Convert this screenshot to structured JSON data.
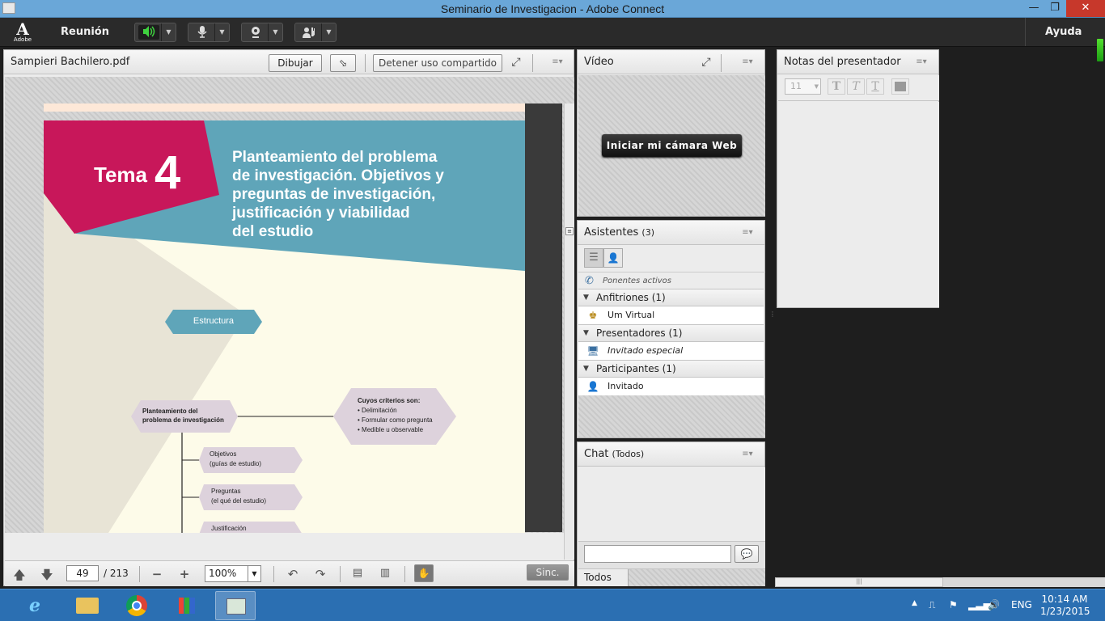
{
  "window": {
    "title": "Seminario de Investigacion - Adobe Connect",
    "minimize": "—",
    "restore": "❐",
    "close": "✕"
  },
  "menubar": {
    "logo_text": "Adobe",
    "meeting_label": "Reunión",
    "help_label": "Ayuda",
    "icons": [
      "speaker-icon",
      "microphone-icon",
      "webcam-icon",
      "raise-hand-icon"
    ]
  },
  "share_pod": {
    "title": "Sampieri Bachilero.pdf",
    "draw_button": "Dibujar",
    "stop_sharing_button": "Detener uso compartido",
    "current_page": "49",
    "total_pages": "/ 213",
    "zoom": "100%",
    "sync_button": "Sinc."
  },
  "slide": {
    "tema_label": "Tema",
    "tema_number": "4",
    "heading_lines": [
      "Planteamiento del problema",
      "de investigación. Objetivos y",
      "preguntas de investigación,",
      "justificación y viabilidad",
      "del estudio"
    ],
    "structure_label": "Estructura",
    "problem_box_lines": [
      "Planteamiento del",
      "problema de investigación"
    ],
    "criteria_title": "Cuyos criterios son:",
    "criteria_items": [
      "• Delimitación",
      "• Formular como pregunta",
      "• Medible u observable"
    ],
    "branch_1": [
      "Objetivos",
      "(guías de estudio)"
    ],
    "branch_2": [
      "Preguntas",
      "(el qué del estudio)"
    ],
    "branch_3": [
      "Justificación"
    ]
  },
  "video_pod": {
    "title": "Vídeo",
    "start_camera_button": "Iniciar mi cámara Web"
  },
  "attendees_pod": {
    "title": "Asistentes",
    "count": "(3)",
    "active_speakers": "Ponentes activos",
    "hosts_header": "Anfitriones (1)",
    "host_name": "Um Virtual",
    "presenters_header": "Presentadores (1)",
    "presenter_name": "Invitado especial",
    "participants_header": "Participantes (1)",
    "participant_name": "Invitado"
  },
  "chat_pod": {
    "title": "Chat",
    "scope": "(Todos)",
    "tab_all": "Todos",
    "input_value": ""
  },
  "notes_pod": {
    "title": "Notas del presentador",
    "font_size": "11"
  },
  "taskbar": {
    "language": "ENG",
    "time": "10:14 AM",
    "date": "1/23/2015"
  },
  "colors": {
    "slide_magenta": "#c8175a",
    "slide_teal": "#5fa5b9",
    "slide_cream": "#fdfbe9",
    "hex_fill": "#ddd2dc",
    "taskbar_blue": "#2b6fb2"
  }
}
